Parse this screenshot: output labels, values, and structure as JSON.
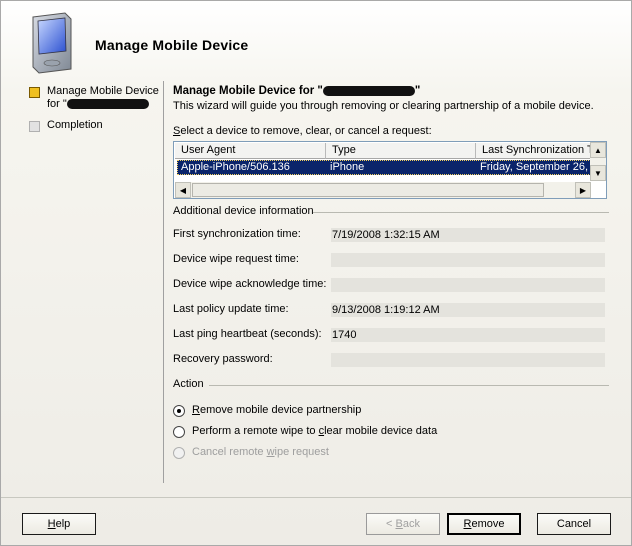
{
  "wizard": {
    "title": "Manage Mobile Device",
    "steps": [
      {
        "label_line1": "Manage Mobile Device",
        "label_prefix": "for \"",
        "status": "active"
      },
      {
        "label": "Completion",
        "status": "inactive"
      }
    ]
  },
  "page": {
    "heading_prefix": "Manage Mobile Device for \"",
    "heading_suffix": "\"",
    "description": "This wizard will guide you through removing or clearing partnership of a mobile device.",
    "select_label_mnemonic": "S",
    "select_label_rest": "elect a device to remove, clear, or cancel a request:"
  },
  "device_list": {
    "columns": [
      "User Agent",
      "Type",
      "Last Synchronization T"
    ],
    "rows": [
      {
        "user_agent": "Apple-iPhone/506.136",
        "type": "iPhone",
        "last_sync": "Friday, September 26, 2"
      }
    ]
  },
  "additional_info": {
    "title": "Additional device information",
    "rows": [
      {
        "label": "First synchronization time:",
        "value": "7/19/2008 1:32:15 AM"
      },
      {
        "label": "Device wipe request time:",
        "value": ""
      },
      {
        "label": "Device wipe acknowledge time:",
        "value": ""
      },
      {
        "label": "Last policy update time:",
        "value": "9/13/2008 1:19:12 AM"
      },
      {
        "label": "Last ping heartbeat (seconds):",
        "value": "1740"
      },
      {
        "label": "Recovery password:",
        "value": ""
      }
    ]
  },
  "action": {
    "title": "Action",
    "options": [
      {
        "pre": "",
        "mn": "R",
        "post": "emove mobile device partnership",
        "checked": true,
        "enabled": true
      },
      {
        "pre": "Perform a remote wipe to ",
        "mn": "c",
        "post": "lear mobile device data",
        "checked": false,
        "enabled": true
      },
      {
        "pre": "Cancel remote ",
        "mn": "w",
        "post": "ipe request",
        "checked": false,
        "enabled": false
      }
    ]
  },
  "buttons": {
    "help": {
      "mn": "H",
      "rest": "elp"
    },
    "back": {
      "pre": "< ",
      "mn": "B",
      "rest": "ack"
    },
    "remove": {
      "mn": "R",
      "rest": "emove"
    },
    "cancel": "Cancel"
  },
  "icons": {
    "header": "pocket-pc-icon",
    "active_step": "current-step-icon",
    "inactive_step": "pending-step-icon"
  },
  "colors": {
    "selection": "#0a246a",
    "active_step": "#f0c020"
  }
}
